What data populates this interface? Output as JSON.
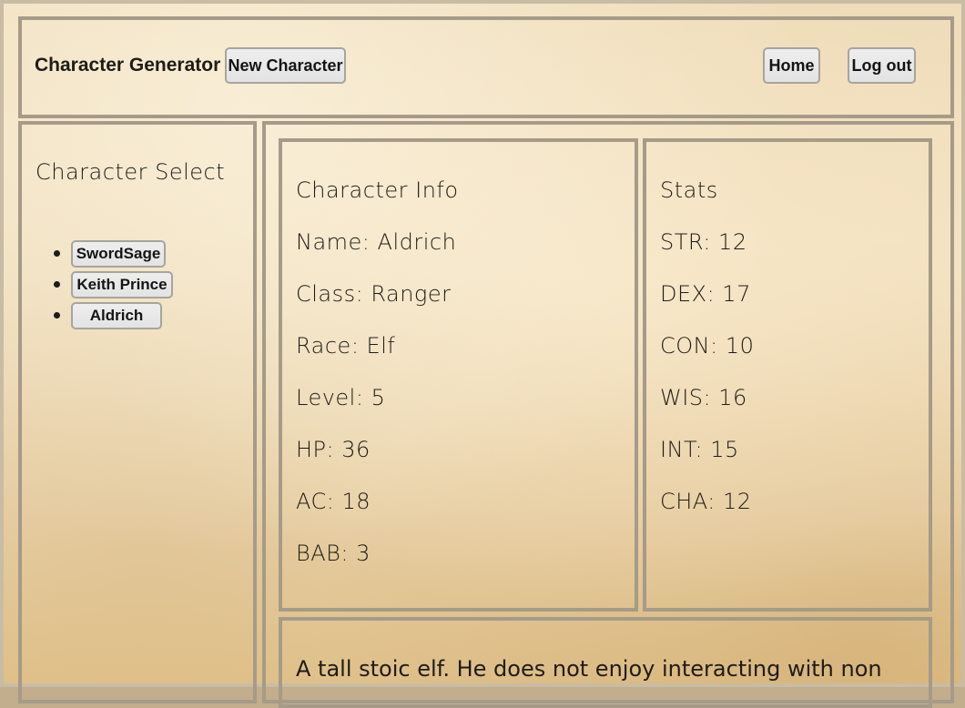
{
  "header": {
    "app_title": "Character Generator",
    "new_character_label": "New Character",
    "home_label": "Home",
    "logout_label": "Log out"
  },
  "sidebar": {
    "heading": "Character Select",
    "characters": [
      {
        "label": "SwordSage"
      },
      {
        "label": "Keith Prince"
      },
      {
        "label": "Aldrich"
      }
    ]
  },
  "info": {
    "heading": "Character Info",
    "name": "Name: Aldrich",
    "class": "Class: Ranger",
    "race": "Race: Elf",
    "level": "Level: 5",
    "hp": "HP: 36",
    "ac": "AC: 18",
    "bab": "BAB: 3"
  },
  "stats": {
    "heading": "Stats",
    "str": "STR: 12",
    "dex": "DEX: 17",
    "con": "CON: 10",
    "wis": "WIS: 16",
    "int": "INT: 15",
    "cha": "CHA: 12"
  },
  "description": {
    "text": "A tall stoic elf. He does not enjoy interacting with non"
  }
}
